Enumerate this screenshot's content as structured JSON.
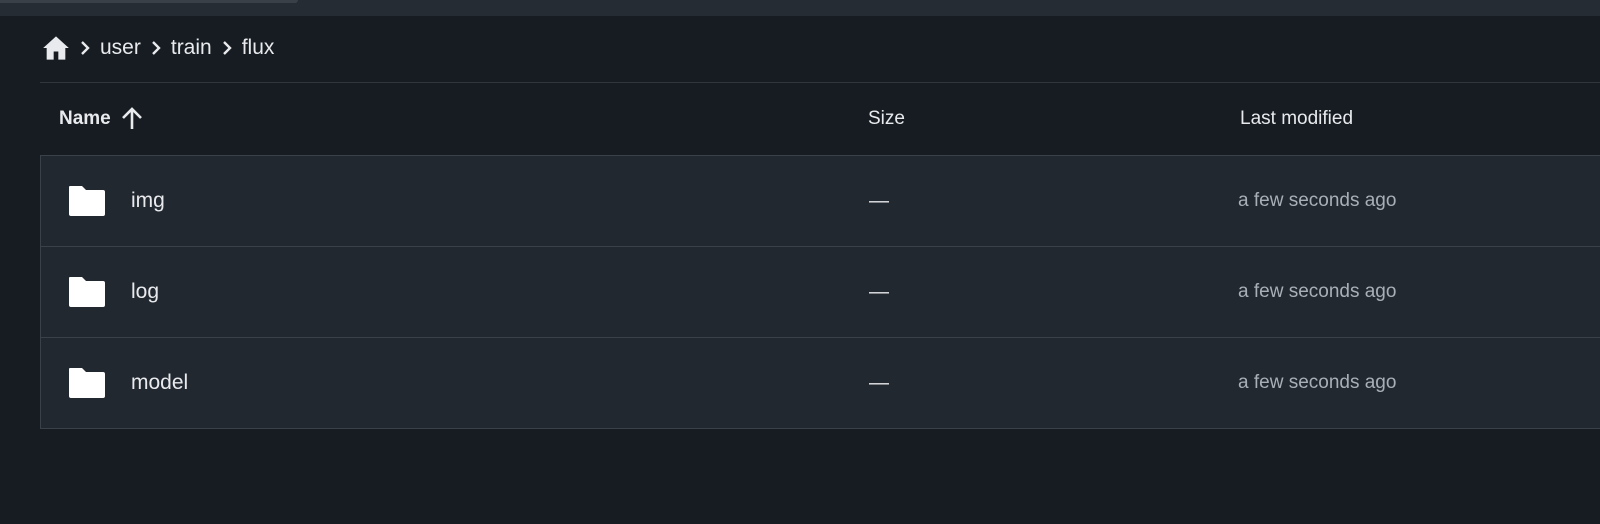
{
  "breadcrumb": {
    "home_icon": "home-icon",
    "items": [
      {
        "label": "user"
      },
      {
        "label": "train"
      },
      {
        "label": "flux"
      }
    ]
  },
  "table": {
    "columns": {
      "name": "Name",
      "size": "Size",
      "modified": "Last modified"
    },
    "sort": {
      "column": "name",
      "direction": "ascending",
      "icon": "arrow-up-icon"
    },
    "rows": [
      {
        "icon": "folder-icon",
        "name": "img",
        "size": "—",
        "modified": "a few seconds ago"
      },
      {
        "icon": "folder-icon",
        "name": "log",
        "size": "—",
        "modified": "a few seconds ago"
      },
      {
        "icon": "folder-icon",
        "name": "model",
        "size": "—",
        "modified": "a few seconds ago"
      }
    ]
  },
  "colors": {
    "background": "#161c22",
    "row_background": "#222830",
    "text": "#e8eaed",
    "muted_text": "#a9afb6",
    "border": "#3a4149"
  }
}
